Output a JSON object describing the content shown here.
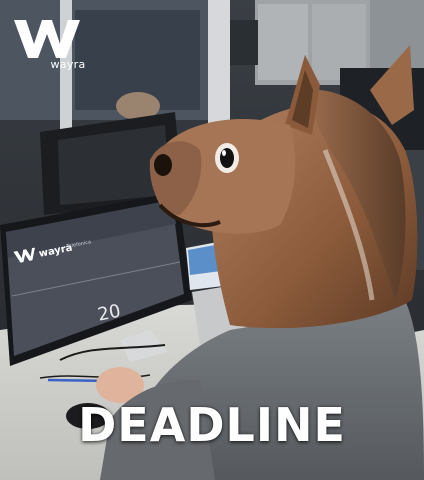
{
  "brand": {
    "name": "wayra"
  },
  "screen": {
    "brand_name": "wayra",
    "subtitle": "Telefonica",
    "number": "20"
  },
  "caption": {
    "text": "DEADLINE"
  },
  "colors": {
    "caption_text": "#ffffff",
    "logo": "#ffffff",
    "horse_mask": "#8a5a3a",
    "sweater": "#6f7479"
  }
}
